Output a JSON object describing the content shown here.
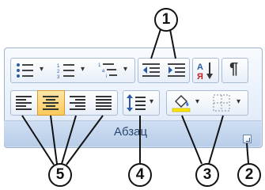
{
  "ribbon_group": {
    "caption": "Абзац"
  },
  "callouts": {
    "c1": "1",
    "c2": "2",
    "c3": "3",
    "c4": "4",
    "c5": "5"
  },
  "icons": {
    "bullets": "bullets-icon",
    "numbering": "numbering-icon",
    "multilevel": "multilevel-list-icon",
    "decrease_indent": "decrease-indent-icon",
    "increase_indent": "increase-indent-icon",
    "sort": "sort-icon",
    "show_marks": "pilcrow-icon",
    "align_left": "align-left-icon",
    "align_center": "align-center-icon",
    "align_right": "align-right-icon",
    "justify": "justify-icon",
    "line_spacing": "line-spacing-icon",
    "shading": "shading-icon",
    "borders": "borders-icon"
  },
  "sort_glyph": "А↓Я",
  "pilcrow": "¶",
  "colors": {
    "accent_selected": "#ffc95a",
    "shading_bar": "#ffe600",
    "group_caption": "#27476e"
  }
}
